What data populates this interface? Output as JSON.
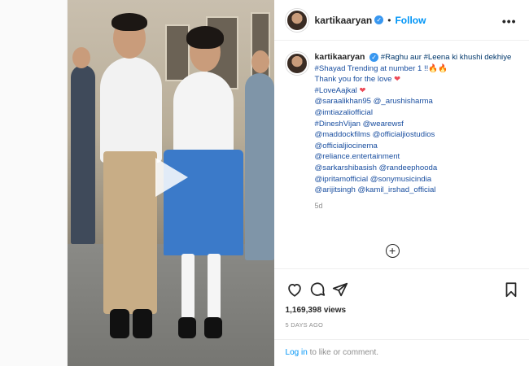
{
  "header": {
    "username": "kartikaaryan",
    "separator": "•",
    "follow_label": "Follow",
    "more_label": "•••"
  },
  "caption": {
    "username": "kartikaaryan",
    "line1": "#Raghu aur #Leena ki khushi dekhiye",
    "line2": "#Shayad Trending at number 1 !!🔥🔥",
    "line3": "Thank you for the love",
    "line4": "#LoveAajkal",
    "mentions": [
      "@saraalikhan95 @_arushisharma",
      "@imtiazaliofficial",
      "#DineshVijan @wearewsf",
      "@maddockfilms @officialjiostudios",
      "@officialjiocinema",
      "@reliance.entertainment",
      "@sarkarshibasish @randeephooda",
      "@ipritamofficial @sonymusicindia",
      "@arijitsingh @kamil_irshad_official"
    ],
    "time": "5d",
    "heart": "❤"
  },
  "load_more_label": "+",
  "stats": {
    "views": "1,169,398 views",
    "ago": "5 DAYS AGO"
  },
  "login": {
    "link": "Log in",
    "rest": " to like or comment."
  },
  "icons": {
    "like": "heart-outline-icon",
    "comment": "comment-bubble-icon",
    "share": "paper-plane-icon",
    "save": "bookmark-icon"
  },
  "colors": {
    "link": "#0095f6",
    "hashtag": "#1a4fa0",
    "heart": "#ed4956",
    "muted": "#8e8e8e"
  }
}
